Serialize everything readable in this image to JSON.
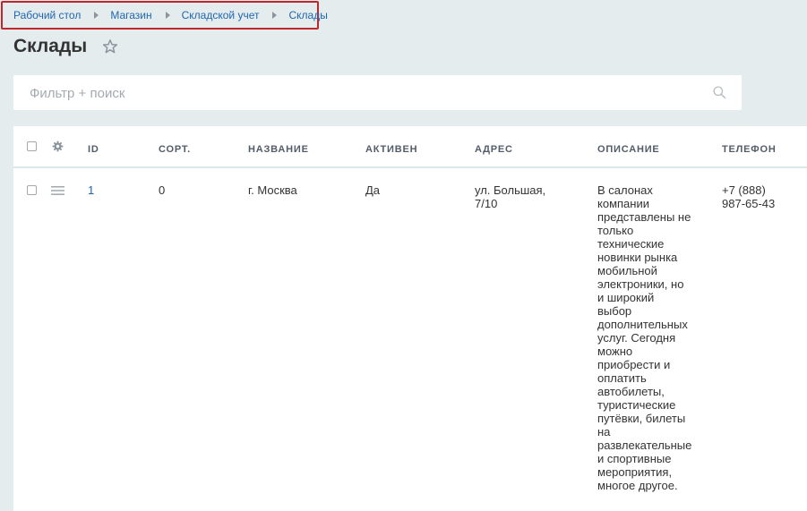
{
  "breadcrumb": {
    "items": [
      "Рабочий стол",
      "Магазин",
      "Складской учет",
      "Склады"
    ]
  },
  "page": {
    "title": "Склады"
  },
  "filter": {
    "placeholder": "Фильтр + поиск"
  },
  "table": {
    "columns": {
      "id": "ID",
      "sort": "СОРТ.",
      "name": "НАЗВАНИЕ",
      "active": "АКТИВЕН",
      "address": "АДРЕС",
      "description": "ОПИСАНИЕ",
      "phone": "ТЕЛЕФОН"
    },
    "rows": [
      {
        "id": "1",
        "sort": "0",
        "name": "г. Москва",
        "active": "Да",
        "address_lines": [
          "ул. Большая,",
          "7/10"
        ],
        "description_lines": [
          "В салонах",
          "компании",
          "представлены не",
          "только",
          "технические",
          "новинки рынка",
          "мобильной",
          "электроники, но",
          "и широкий",
          "выбор",
          "дополнительных",
          "услуг. Сегодня",
          "можно",
          "приобрести и",
          "оплатить",
          "автобилеты,",
          "туристические",
          "путёвки, билеты",
          "на",
          "развлекательные",
          "и спортивные",
          "мероприятия,",
          "многое другое."
        ],
        "phone_lines": [
          "+7 (888)",
          "987-65-43"
        ]
      }
    ]
  },
  "icons": {
    "star": "star-outline-icon",
    "search": "magnifier-icon",
    "settings": "gear-icon",
    "row_menu": "hamburger-icon"
  },
  "colors": {
    "background": "#e4ecee",
    "link": "#2067b0",
    "highlight_border": "#c0262c"
  }
}
